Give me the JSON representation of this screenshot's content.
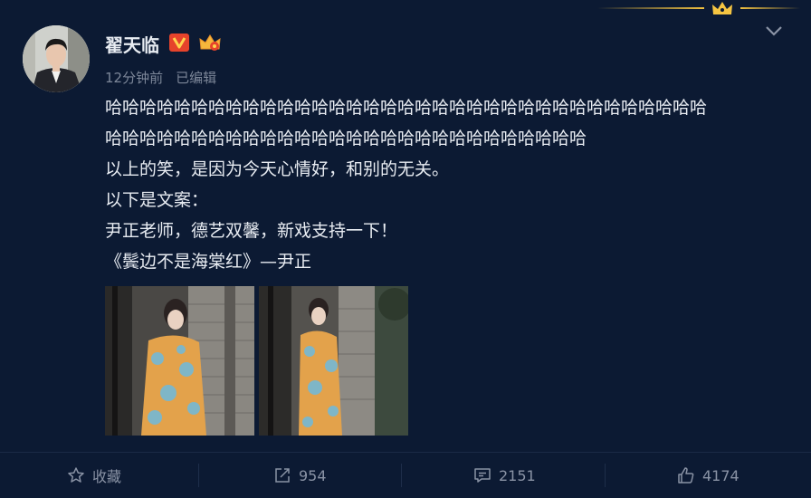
{
  "user": {
    "name": "翟天临",
    "time": "12分钟前",
    "edited": "已编辑"
  },
  "post": {
    "lines": [
      "哈哈哈哈哈哈哈哈哈哈哈哈哈哈哈哈哈哈哈哈哈哈哈哈哈哈哈哈哈哈哈哈哈哈哈",
      "哈哈哈哈哈哈哈哈哈哈哈哈哈哈哈哈哈哈哈哈哈哈哈哈哈哈哈哈",
      "以上的笑，是因为今天心情好，和别的无关。",
      "以下是文案：",
      "尹正老师，德艺双馨，新戏支持一下！",
      "《鬓边不是海棠红》—尹正"
    ]
  },
  "actions": {
    "favorite_label": "收藏",
    "repost_count": "954",
    "comment_count": "2151",
    "like_count": "4174"
  },
  "colors": {
    "background": "#0c1a33",
    "text": "#e8ecf2",
    "muted": "#8a93a5",
    "verified_badge": "#e6432b",
    "gold": "#f0c040"
  },
  "icons": [
    "crown-icon",
    "chevron-down-icon",
    "verified-v-icon",
    "vip-crown-icon",
    "star-icon",
    "repost-icon",
    "comment-icon",
    "like-icon"
  ]
}
